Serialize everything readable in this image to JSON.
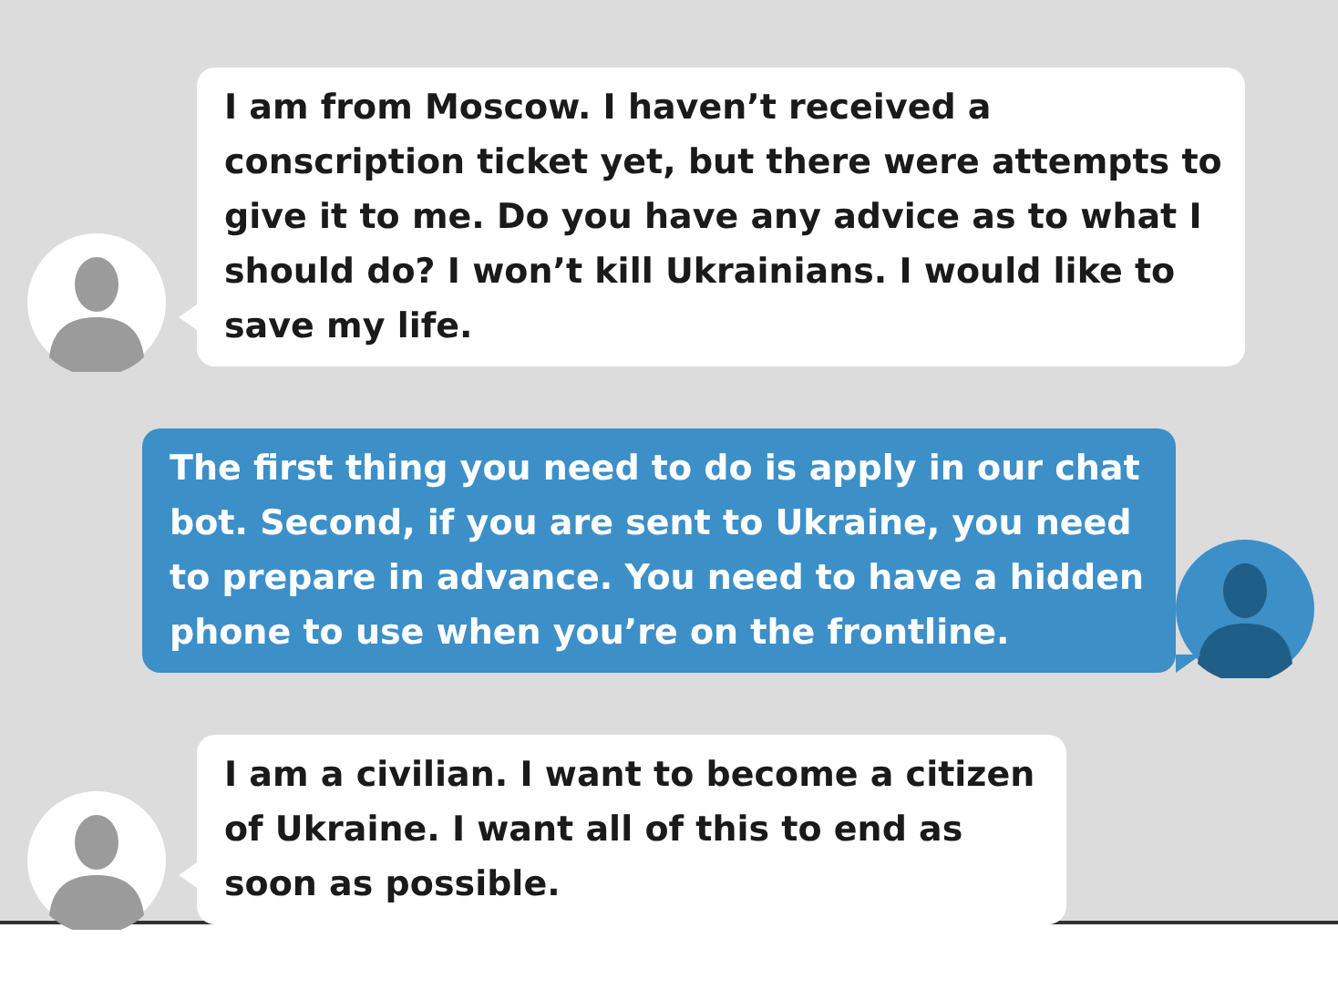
{
  "messages": [
    {
      "kind": "incoming",
      "text": "I am from Moscow. I haven’t received a conscription ticket yet, but there were attempts to give it to me. Do you have any advice as to what I should do? I won’t kill Ukrainians. I would like to save my life."
    },
    {
      "kind": "outgoing",
      "text": "The first thing you need to do is apply in our chat bot. Second, if you are sent to Ukraine, you need to prepare in advance. You need to have a hidden phone to use when you’re on the frontline."
    },
    {
      "kind": "incoming",
      "text": " I am a civilian. I want to become a citizen of Ukraine. I want all of this to end as soon as possible."
    }
  ]
}
